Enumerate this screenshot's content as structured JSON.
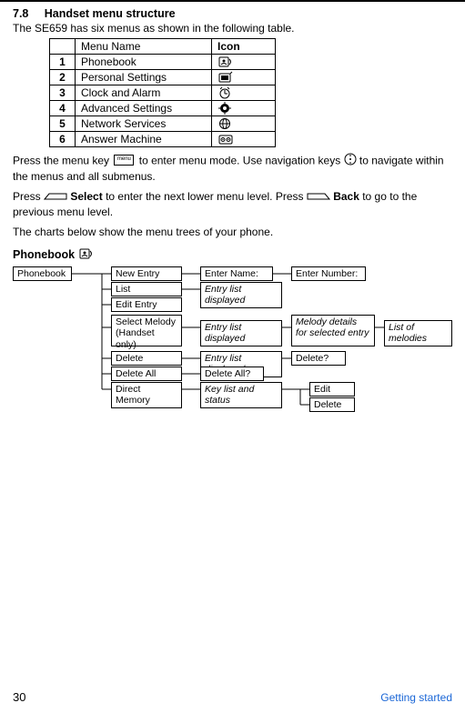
{
  "section": {
    "number": "7.8",
    "title": "Handset menu structure"
  },
  "intro": "The SE659 has six menus as shown in the following table.",
  "table_headers": {
    "col1": "",
    "col2": "Menu Name",
    "col3": "Icon"
  },
  "menu_items": [
    {
      "num": "1",
      "name": "Phonebook",
      "icon": "phonebook-icon"
    },
    {
      "num": "2",
      "name": "Personal Settings",
      "icon": "personal-settings-icon"
    },
    {
      "num": "3",
      "name": "Clock and Alarm",
      "icon": "clock-alarm-icon"
    },
    {
      "num": "4",
      "name": "Advanced Settings",
      "icon": "advanced-settings-icon"
    },
    {
      "num": "5",
      "name": "Network Services",
      "icon": "network-services-icon"
    },
    {
      "num": "6",
      "name": "Answer Machine",
      "icon": "answer-machine-icon"
    }
  ],
  "para1_a": "Press the menu key ",
  "para1_b": " to enter menu mode. Use navigation keys ",
  "para1_c": " to navigate within the menus and all submenus.",
  "para2_a": "Press ",
  "para2_select": "Select",
  "para2_b": " to enter the next lower menu level. Press ",
  "para2_back": "Back",
  "para2_c": " to go to the previous menu level.",
  "para3": "The charts below show the menu trees of your phone.",
  "phonebook_title": "Phonebook",
  "tree": {
    "root": "Phonebook",
    "level1": [
      "New Entry",
      "List",
      "Edit Entry",
      "Select Melody (Handset only)",
      "Delete",
      "Delete All",
      "Direct Memory"
    ],
    "new_entry_step1": "Enter Name:",
    "new_entry_step2": "Enter Number:",
    "list_step1": "Entry list displayed",
    "melody_step1": "Entry list displayed",
    "melody_step2": "Melody details for selected entry",
    "melody_step3": "List of melodies",
    "delete_step1": "Entry list displayed",
    "delete_step2": "Delete?",
    "delete_all_step1": "Delete All?",
    "direct_step1": "Key list and status",
    "direct_opt1": "Edit",
    "direct_opt2": "Delete"
  },
  "footer": {
    "page": "30",
    "section": "Getting started"
  },
  "menu_key_label": "menu"
}
